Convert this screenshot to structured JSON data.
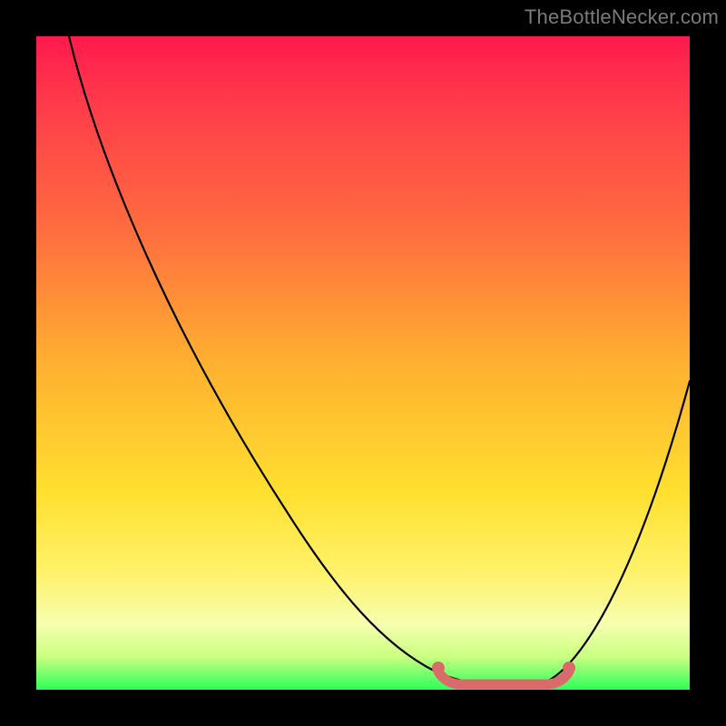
{
  "page": {
    "watermark": "TheBottleNecker.com"
  },
  "chart_data": {
    "type": "line",
    "title": "",
    "xlabel": "",
    "ylabel": "",
    "xlim": [
      0,
      100
    ],
    "ylim": [
      0,
      100
    ],
    "grid": false,
    "legend": false,
    "background_gradient": [
      "#ff1a4d",
      "#ff6e3f",
      "#ffe030",
      "#f6ffb0",
      "#2bff5a"
    ],
    "series": [
      {
        "name": "bottleneck-curve",
        "color": "#000000",
        "x": [
          5,
          10,
          15,
          20,
          25,
          30,
          35,
          40,
          45,
          50,
          55,
          60,
          62,
          65,
          70,
          75,
          80,
          85,
          90,
          95,
          100
        ],
        "y": [
          100,
          92,
          84,
          76,
          68,
          60,
          52,
          44,
          36,
          28,
          20,
          12,
          9,
          5,
          1,
          0,
          1,
          6,
          17,
          33,
          50
        ]
      }
    ],
    "highlight_range": {
      "name": "optimal-range",
      "color": "#db6a6a",
      "x_start": 62,
      "x_end": 82
    }
  }
}
